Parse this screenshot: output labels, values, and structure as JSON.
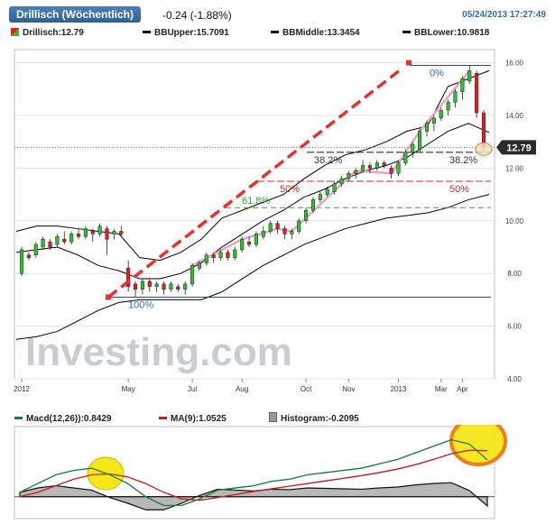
{
  "header": {
    "title": "Drillisch (Wöchentlich)",
    "change": "-0.24 (-1.88%)",
    "timestamp": "05/24/2013 17:27:49"
  },
  "price_legend": {
    "last": "Drillisch:12.79",
    "bb_upper": "BBUpper:15.7091",
    "bb_middle": "BBMiddle:13.3454",
    "bb_lower": "BBLower:10.9818"
  },
  "macd_legend": {
    "macd": "Macd(12,26)):0.8429",
    "ma": "MA(9):1.0525",
    "histogram": "Histogram:-0.2095"
  },
  "colors": {
    "up": "#2fbf2f",
    "down": "#e02020",
    "bb": "#000000",
    "fib_arrow": "#e83030",
    "fib_line": "#f0a0c0",
    "fib_level": "#c03030",
    "macd": "#1a7a3a",
    "ma": "#c02020",
    "histogram": "#999999",
    "highlight_yellow": "#f5e400",
    "highlight_orange": "#f07f1a"
  },
  "watermark": "Investing.com",
  "chart_data": [
    {
      "type": "candlestick",
      "y_axis_ticks": [
        "4.00",
        "6.00",
        "8.00",
        "10.00",
        "12.00",
        "14.00",
        "16.00"
      ],
      "ylim": [
        4,
        16.5
      ],
      "x_tick_labels": [
        "2012",
        "May",
        "Jul",
        "Aug",
        "Oct",
        "Nov",
        "2013",
        "Mar",
        "Apr"
      ],
      "last_price_label": "12.79",
      "last_price": 12.79,
      "candles": [
        {
          "o": 8.0,
          "c": 8.9,
          "h": 9.0,
          "l": 7.9
        },
        {
          "o": 8.7,
          "c": 8.6,
          "h": 8.8,
          "l": 8.5
        },
        {
          "o": 8.7,
          "c": 9.1,
          "h": 9.2,
          "l": 8.6
        },
        {
          "o": 9.0,
          "c": 9.3,
          "h": 9.4,
          "l": 8.9
        },
        {
          "o": 9.2,
          "c": 9.0,
          "h": 9.3,
          "l": 8.9
        },
        {
          "o": 9.1,
          "c": 9.4,
          "h": 9.5,
          "l": 9.0
        },
        {
          "o": 9.3,
          "c": 9.2,
          "h": 9.6,
          "l": 9.1
        },
        {
          "o": 9.2,
          "c": 9.5,
          "h": 9.6,
          "l": 9.1
        },
        {
          "o": 9.5,
          "c": 9.4,
          "h": 9.7,
          "l": 9.3
        },
        {
          "o": 9.4,
          "c": 9.7,
          "h": 9.8,
          "l": 9.3
        },
        {
          "o": 9.6,
          "c": 9.5,
          "h": 9.7,
          "l": 9.2
        },
        {
          "o": 9.5,
          "c": 9.8,
          "h": 9.9,
          "l": 9.4
        },
        {
          "o": 9.7,
          "c": 9.3,
          "h": 9.8,
          "l": 8.7
        },
        {
          "o": 9.5,
          "c": 9.6,
          "h": 9.7,
          "l": 9.3
        },
        {
          "o": 9.6,
          "c": 9.5,
          "h": 9.8,
          "l": 9.4
        },
        {
          "o": 8.2,
          "c": 7.5,
          "h": 8.5,
          "l": 7.3
        },
        {
          "o": 7.6,
          "c": 7.4,
          "h": 7.7,
          "l": 7.1
        },
        {
          "o": 7.4,
          "c": 7.7,
          "h": 7.8,
          "l": 7.2
        },
        {
          "o": 7.7,
          "c": 7.5,
          "h": 7.8,
          "l": 7.3
        },
        {
          "o": 7.5,
          "c": 7.6,
          "h": 7.7,
          "l": 7.3
        },
        {
          "o": 7.6,
          "c": 7.4,
          "h": 7.7,
          "l": 7.2
        },
        {
          "o": 7.4,
          "c": 7.6,
          "h": 7.7,
          "l": 7.3
        },
        {
          "o": 7.5,
          "c": 7.4,
          "h": 7.6,
          "l": 7.3
        },
        {
          "o": 7.4,
          "c": 7.6,
          "h": 7.7,
          "l": 7.2
        },
        {
          "o": 7.6,
          "c": 8.3,
          "h": 8.4,
          "l": 7.5
        },
        {
          "o": 8.2,
          "c": 8.4,
          "h": 8.5,
          "l": 8.1
        },
        {
          "o": 8.4,
          "c": 8.7,
          "h": 8.8,
          "l": 8.3
        },
        {
          "o": 8.7,
          "c": 8.6,
          "h": 8.8,
          "l": 8.4
        },
        {
          "o": 8.6,
          "c": 8.8,
          "h": 8.9,
          "l": 8.5
        },
        {
          "o": 8.8,
          "c": 8.6,
          "h": 8.9,
          "l": 8.5
        },
        {
          "o": 8.6,
          "c": 8.9,
          "h": 9.0,
          "l": 8.5
        },
        {
          "o": 8.9,
          "c": 9.3,
          "h": 9.4,
          "l": 8.8
        },
        {
          "o": 9.2,
          "c": 9.1,
          "h": 9.4,
          "l": 9.0
        },
        {
          "o": 9.1,
          "c": 9.5,
          "h": 9.6,
          "l": 9.0
        },
        {
          "o": 9.4,
          "c": 9.6,
          "h": 9.8,
          "l": 9.3
        },
        {
          "o": 9.6,
          "c": 9.9,
          "h": 10.0,
          "l": 9.5
        },
        {
          "o": 9.9,
          "c": 9.7,
          "h": 10.0,
          "l": 9.5
        },
        {
          "o": 9.7,
          "c": 9.5,
          "h": 9.8,
          "l": 9.3
        },
        {
          "o": 9.5,
          "c": 9.6,
          "h": 9.7,
          "l": 9.3
        },
        {
          "o": 9.6,
          "c": 10.0,
          "h": 10.1,
          "l": 9.5
        },
        {
          "o": 10.0,
          "c": 10.4,
          "h": 10.5,
          "l": 9.9
        },
        {
          "o": 10.4,
          "c": 10.8,
          "h": 10.9,
          "l": 10.3
        },
        {
          "o": 10.8,
          "c": 11.0,
          "h": 11.1,
          "l": 10.7
        },
        {
          "o": 11.0,
          "c": 11.2,
          "h": 11.3,
          "l": 10.9
        },
        {
          "o": 11.1,
          "c": 11.4,
          "h": 11.5,
          "l": 11.0
        },
        {
          "o": 11.4,
          "c": 11.6,
          "h": 11.7,
          "l": 11.3
        },
        {
          "o": 11.6,
          "c": 11.8,
          "h": 11.9,
          "l": 11.5
        },
        {
          "o": 11.8,
          "c": 11.9,
          "h": 12.0,
          "l": 11.6
        },
        {
          "o": 11.9,
          "c": 12.1,
          "h": 12.3,
          "l": 11.8
        },
        {
          "o": 12.1,
          "c": 12.0,
          "h": 12.2,
          "l": 11.8
        },
        {
          "o": 12.0,
          "c": 12.2,
          "h": 12.3,
          "l": 11.9
        },
        {
          "o": 12.2,
          "c": 12.1,
          "h": 12.3,
          "l": 12.0
        },
        {
          "o": 12.0,
          "c": 11.8,
          "h": 12.1,
          "l": 11.6
        },
        {
          "o": 11.8,
          "c": 12.2,
          "h": 12.3,
          "l": 11.7
        },
        {
          "o": 12.2,
          "c": 12.6,
          "h": 12.7,
          "l": 12.1
        },
        {
          "o": 12.6,
          "c": 12.9,
          "h": 13.0,
          "l": 12.4
        },
        {
          "o": 12.7,
          "c": 13.4,
          "h": 13.5,
          "l": 12.6
        },
        {
          "o": 13.4,
          "c": 13.7,
          "h": 13.8,
          "l": 13.2
        },
        {
          "o": 13.7,
          "c": 13.9,
          "h": 14.0,
          "l": 13.4
        },
        {
          "o": 13.9,
          "c": 14.2,
          "h": 14.3,
          "l": 13.8
        },
        {
          "o": 14.2,
          "c": 14.5,
          "h": 14.6,
          "l": 14.0
        },
        {
          "o": 14.5,
          "c": 14.9,
          "h": 15.0,
          "l": 14.3
        },
        {
          "o": 14.9,
          "c": 15.4,
          "h": 15.5,
          "l": 14.6
        },
        {
          "o": 15.3,
          "c": 15.7,
          "h": 15.9,
          "l": 15.2
        },
        {
          "o": 15.6,
          "c": 14.1,
          "h": 15.7,
          "l": 13.9
        },
        {
          "o": 14.1,
          "c": 12.79,
          "h": 14.2,
          "l": 12.6
        }
      ],
      "bb_upper": [
        9.6,
        9.8,
        9.8,
        9.7,
        9.6,
        9.5,
        8.6,
        8.5,
        8.8,
        9.3,
        10.1,
        10.4,
        10.7,
        11.0,
        11.6,
        12.1,
        12.5,
        12.7,
        13.0,
        13.4,
        13.6,
        15.1,
        15.4,
        15.7
      ],
      "bb_middle": [
        8.8,
        8.9,
        9.0,
        8.7,
        8.3,
        8.1,
        7.8,
        7.8,
        8.0,
        8.4,
        9.0,
        9.5,
        10.0,
        10.4,
        10.9,
        11.2,
        11.6,
        11.9,
        12.1,
        12.4,
        12.9,
        13.4,
        13.7,
        13.35
      ],
      "bb_lower": [
        5.5,
        5.6,
        5.8,
        6.2,
        6.6,
        6.9,
        7.0,
        7.0,
        7.0,
        7.0,
        7.3,
        7.8,
        8.3,
        8.7,
        9.1,
        9.4,
        9.7,
        9.9,
        10.1,
        10.2,
        10.3,
        10.5,
        10.8,
        11.0
      ],
      "fibonacci": {
        "levels": [
          {
            "label": "0%",
            "value": 15.9
          },
          {
            "label": "38.2%",
            "value": 12.6
          },
          {
            "label": "50%",
            "value": 11.5
          },
          {
            "label": "61.8%",
            "value": 10.5
          },
          {
            "label": "100%",
            "value": 7.1
          }
        ],
        "arrow": {
          "from": 7.1,
          "to": 16.0
        }
      }
    },
    {
      "type": "macd",
      "macd": [
        0.1,
        0.3,
        0.5,
        0.6,
        0.65,
        0.5,
        0.3,
        0.0,
        -0.2,
        -0.2,
        -0.05,
        0.15,
        0.2,
        0.25,
        0.35,
        0.4,
        0.5,
        0.55,
        0.6,
        0.65,
        0.75,
        0.85,
        1.0,
        1.15,
        1.3,
        1.2,
        0.84
      ],
      "signal": [
        0.0,
        0.1,
        0.25,
        0.4,
        0.5,
        0.52,
        0.45,
        0.3,
        0.1,
        -0.05,
        -0.08,
        -0.02,
        0.05,
        0.12,
        0.18,
        0.24,
        0.3,
        0.36,
        0.42,
        0.48,
        0.55,
        0.63,
        0.73,
        0.85,
        0.98,
        1.06,
        1.05
      ],
      "histogram": [
        0.1,
        0.2,
        0.25,
        0.2,
        0.15,
        -0.02,
        -0.15,
        -0.3,
        -0.3,
        -0.15,
        0.03,
        0.17,
        0.15,
        0.13,
        0.17,
        0.16,
        0.2,
        0.19,
        0.18,
        0.17,
        0.2,
        0.22,
        0.27,
        0.3,
        0.32,
        0.14,
        -0.21
      ]
    }
  ]
}
